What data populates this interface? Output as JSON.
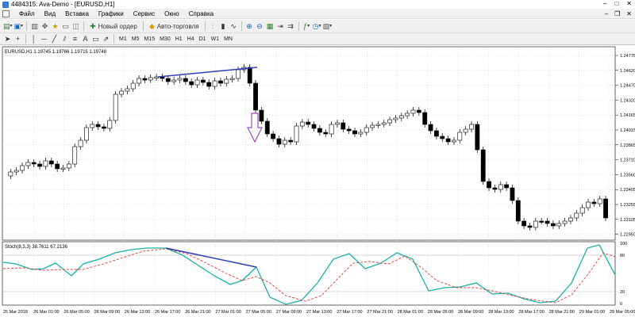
{
  "window": {
    "title": "4484315: Ava-Demo - [EURUSD,H1]",
    "controls": [
      "–",
      "□",
      "✕"
    ],
    "mdi_controls": [
      "–",
      "❐",
      "✕"
    ]
  },
  "menu": {
    "items": [
      "Файл",
      "Вид",
      "Вставка",
      "Графики",
      "Сервис",
      "Окно",
      "Справка"
    ]
  },
  "toolbar1": {
    "new_order_label": "Новый ордер",
    "auto_trading_label": "Авто-торговля"
  },
  "toolbar2": {
    "timeframes": [
      "M1",
      "M5",
      "M15",
      "M30",
      "H1",
      "H4",
      "D1",
      "W1",
      "MN"
    ]
  },
  "chart": {
    "symbol_header": "EURUSD,H1  1.19745 1.19766 1.19715 1.19748",
    "price_labels": [
      "1.24775",
      "1.24620",
      "1.24470",
      "1.24320",
      "1.24165",
      "1.24015",
      "1.23865",
      "1.23710",
      "1.23560",
      "1.23405",
      "1.23255",
      "1.23105",
      "1.22950"
    ],
    "indicator_header": "Stoch(8,3,3) 38.7611 67.2136",
    "indicator_labels": [
      "100",
      "80",
      "20",
      "0"
    ],
    "time_labels": [
      "25 Mar 2018",
      "26 Mar 01:00",
      "26 Mar 05:00",
      "26 Mar 09:00",
      "26 Mar 13:00",
      "26 Mar 17:00",
      "26 Mar 21:00",
      "27 Mar 01:00",
      "27 Mar 05:00",
      "27 Mar 09:00",
      "27 Mar 13:00",
      "27 Mar 17:00",
      "27 Mar 21:00",
      "28 Mar 01:00",
      "28 Mar 05:00",
      "28 Mar 09:00",
      "28 Mar 13:00",
      "28 Mar 17:00",
      "28 Mar 21:00",
      "29 Mar 01:00",
      "29 Mar 05:00"
    ]
  },
  "colors": {
    "bull_fill": "#ffffff",
    "bear_fill": "#000000",
    "trendline": "#2c3fb8",
    "arrow": "#9b4db5",
    "stoch_main": "#1bb1a8",
    "stoch_signal": "#e53935"
  }
}
